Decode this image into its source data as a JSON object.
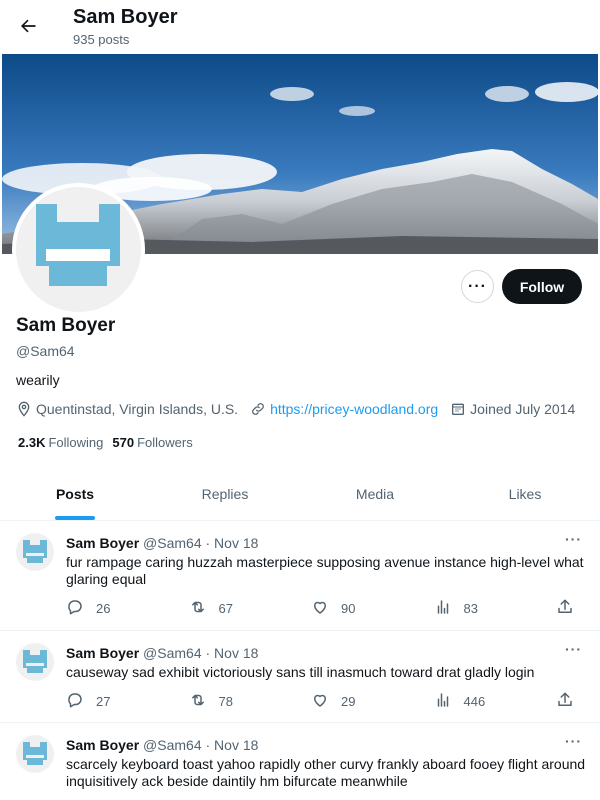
{
  "header": {
    "title": "Sam Boyer",
    "subtitle": "935 posts"
  },
  "profile": {
    "name": "Sam Boyer",
    "handle": "@Sam64",
    "bio": "wearily",
    "location": "Quentinstad, Virgin Islands, U.S.",
    "website": "https://pricey-woodland.org",
    "joined": "Joined July 2014",
    "following_count": "2.3K",
    "following_label": "Following",
    "followers_count": "570",
    "followers_label": "Followers",
    "follow_label": "Follow",
    "more_label": "···"
  },
  "tabs": [
    {
      "label": "Posts"
    },
    {
      "label": "Replies"
    },
    {
      "label": "Media"
    },
    {
      "label": "Likes"
    }
  ],
  "posts": [
    {
      "name": "Sam Boyer",
      "meta": "@Sam64 · Nov 18",
      "text": "fur rampage caring huzzah masterpiece supposing avenue instance high-level what glaring equal",
      "replies": "26",
      "reposts": "67",
      "likes": "90",
      "views": "83"
    },
    {
      "name": "Sam Boyer",
      "meta": "@Sam64 · Nov 18",
      "text": "causeway sad exhibit victoriously sans till inasmuch toward drat gladly login",
      "replies": "27",
      "reposts": "78",
      "likes": "29",
      "views": "446"
    },
    {
      "name": "Sam Boyer",
      "meta": "@Sam64 · Nov 18",
      "text": "scarcely keyboard toast yahoo rapidly other curvy frankly aboard fooey flight around inquisitively ack beside daintily hm bifurcate meanwhile",
      "replies": "",
      "reposts": "",
      "likes": "",
      "views": ""
    }
  ],
  "post_more_label": "···",
  "colors": {
    "accent": "#1d9bf0",
    "text": "#0f1419",
    "muted": "#536471",
    "avatar_blue": "#6bb8d8"
  },
  "icons": [
    "back-arrow-icon",
    "location-icon",
    "link-icon",
    "calendar-icon",
    "reply-icon",
    "repost-icon",
    "like-icon",
    "views-icon",
    "share-icon"
  ]
}
